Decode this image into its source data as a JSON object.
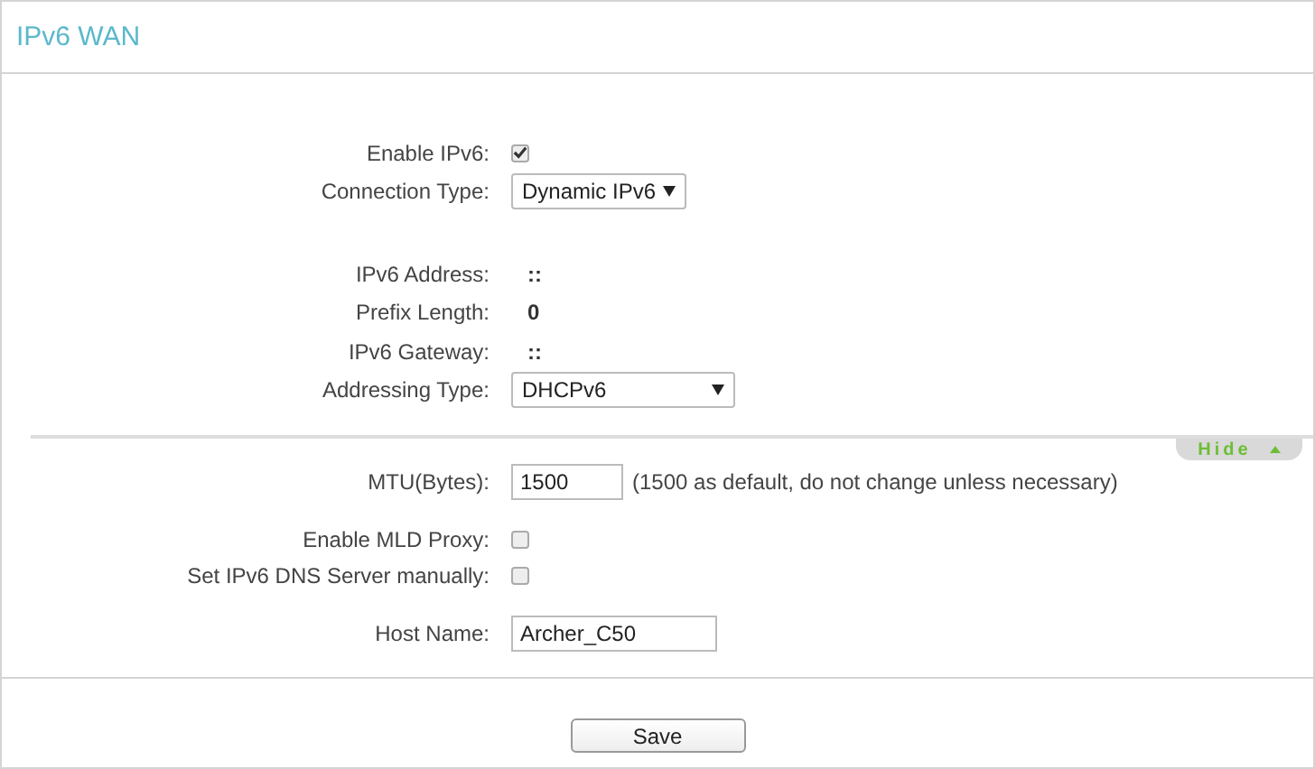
{
  "title": "IPv6 WAN",
  "fields": [
    {
      "kind": "checkbox",
      "label": "Enable IPv6:",
      "checked": true
    },
    {
      "kind": "select",
      "label": "Connection Type:",
      "value": "Dynamic IPv6",
      "wide": false
    },
    {
      "kind": "spacer"
    },
    {
      "kind": "readonly",
      "label": "IPv6 Address:",
      "value": "::"
    },
    {
      "kind": "readonly",
      "label": "Prefix Length:",
      "value": "0"
    },
    {
      "kind": "readonly",
      "label": "IPv6 Gateway:",
      "value": "::"
    },
    {
      "kind": "select",
      "label": "Addressing Type:",
      "value": "DHCPv6",
      "wide": true
    }
  ],
  "toggle": {
    "label": "Hide",
    "expanded": true
  },
  "advanced": [
    {
      "kind": "input",
      "label": "MTU(Bytes):",
      "value": "1500",
      "wide": false,
      "hint": "(1500 as default, do not change unless necessary)"
    },
    {
      "kind": "spacer"
    },
    {
      "kind": "checkbox",
      "label": "Enable MLD Proxy:",
      "checked": false
    },
    {
      "kind": "checkbox",
      "label": "Set IPv6 DNS Server manually:",
      "checked": false
    },
    {
      "kind": "spacer"
    },
    {
      "kind": "input",
      "label": "Host Name:",
      "value": "Archer_C50",
      "wide": true
    }
  ],
  "save_button": "Save"
}
